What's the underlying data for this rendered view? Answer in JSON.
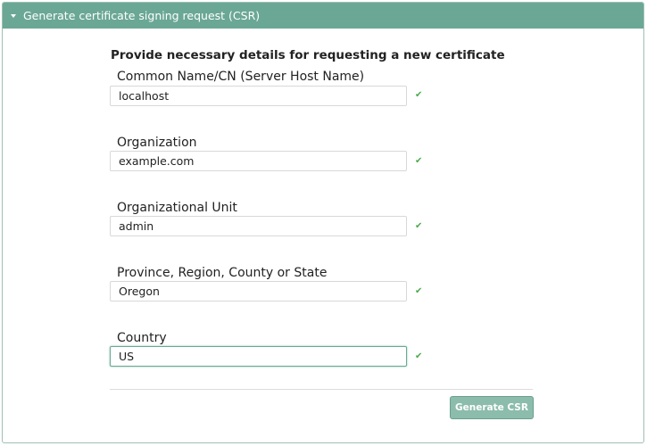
{
  "panel": {
    "title": "Generate certificate signing request (CSR)"
  },
  "form": {
    "heading": "Provide necessary details for requesting a new certificate",
    "fields": [
      {
        "label": "Common Name/CN (Server Host Name)",
        "value": "localhost",
        "valid": true
      },
      {
        "label": "Organization",
        "value": "example.com",
        "valid": true
      },
      {
        "label": "Organizational Unit",
        "value": "admin",
        "valid": true
      },
      {
        "label": "Province, Region, County or State",
        "value": "Oregon",
        "valid": true
      },
      {
        "label": "Country",
        "value": "US",
        "valid": true
      }
    ],
    "check_glyph": "✔",
    "submit_label": "Generate CSR"
  },
  "colors": {
    "header_bg": "#6ba795",
    "button_bg": "#8cbcab",
    "check": "#4caa4c",
    "focus_border": "#6aa894"
  },
  "icons": {
    "header_toggle": "caret-down-icon",
    "field_status": "checkmark-icon"
  }
}
